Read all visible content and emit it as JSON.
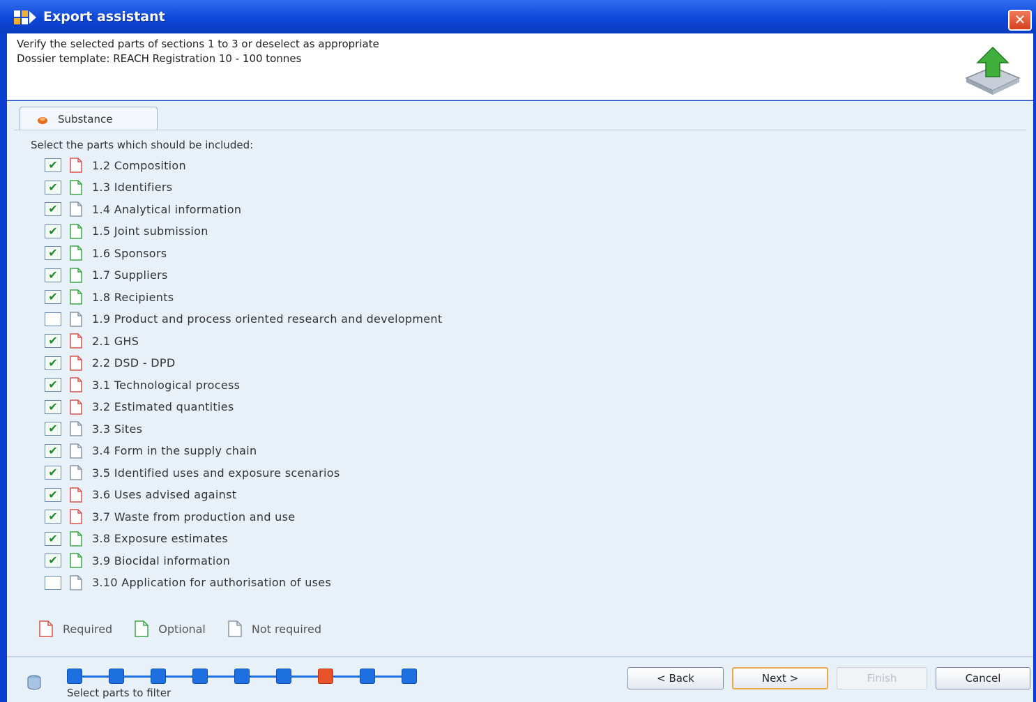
{
  "window": {
    "title": "Export assistant",
    "close_glyph": "✕"
  },
  "header": {
    "line1": "Verify the selected parts of sections 1 to 3 or deselect as appropriate",
    "line2": "Dossier template: REACH Registration 10 - 100 tonnes",
    "icon": "export-arrow-icon"
  },
  "tab": {
    "label": "Substance"
  },
  "instruction": "Select the parts which should be included:",
  "parts": [
    {
      "label": "1.2 Composition",
      "checked": true,
      "doc": "required"
    },
    {
      "label": "1.3 Identifiers",
      "checked": true,
      "doc": "optional"
    },
    {
      "label": "1.4 Analytical information",
      "checked": true,
      "doc": "not-required"
    },
    {
      "label": "1.5 Joint submission",
      "checked": true,
      "doc": "optional"
    },
    {
      "label": "1.6 Sponsors",
      "checked": true,
      "doc": "optional"
    },
    {
      "label": "1.7 Suppliers",
      "checked": true,
      "doc": "optional"
    },
    {
      "label": "1.8 Recipients",
      "checked": true,
      "doc": "optional"
    },
    {
      "label": "1.9 Product and process oriented research and development",
      "checked": false,
      "doc": "not-required"
    },
    {
      "label": "2.1 GHS",
      "checked": true,
      "doc": "required"
    },
    {
      "label": "2.2 DSD - DPD",
      "checked": true,
      "doc": "required"
    },
    {
      "label": "3.1 Technological process",
      "checked": true,
      "doc": "required"
    },
    {
      "label": "3.2 Estimated quantities",
      "checked": true,
      "doc": "required"
    },
    {
      "label": "3.3 Sites",
      "checked": true,
      "doc": "not-required"
    },
    {
      "label": "3.4 Form in the supply chain",
      "checked": true,
      "doc": "not-required"
    },
    {
      "label": "3.5 Identified uses and exposure scenarios",
      "checked": true,
      "doc": "not-required"
    },
    {
      "label": "3.6 Uses advised against",
      "checked": true,
      "doc": "required"
    },
    {
      "label": "3.7 Waste from production and use",
      "checked": true,
      "doc": "required"
    },
    {
      "label": "3.8 Exposure estimates",
      "checked": true,
      "doc": "optional"
    },
    {
      "label": "3.9 Biocidal information",
      "checked": true,
      "doc": "optional"
    },
    {
      "label": "3.10 Application for authorisation of uses",
      "checked": false,
      "doc": "not-required"
    }
  ],
  "legend": {
    "required": "Required",
    "optional": "Optional",
    "not_required": "Not required"
  },
  "steps": {
    "count": 9,
    "current_index": 6,
    "caption": "Select parts to filter"
  },
  "buttons": {
    "back": "< Back",
    "next": "Next >",
    "finish": "Finish",
    "cancel": "Cancel"
  },
  "colors": {
    "title_bar": "#0d47d8",
    "panel_bg": "#e8f1f8",
    "required_doc": "#d9534f",
    "optional_doc": "#3ba84a",
    "not_required_doc": "#8a97a8",
    "step": "#1e6fe0",
    "current_step": "#e8532a"
  }
}
